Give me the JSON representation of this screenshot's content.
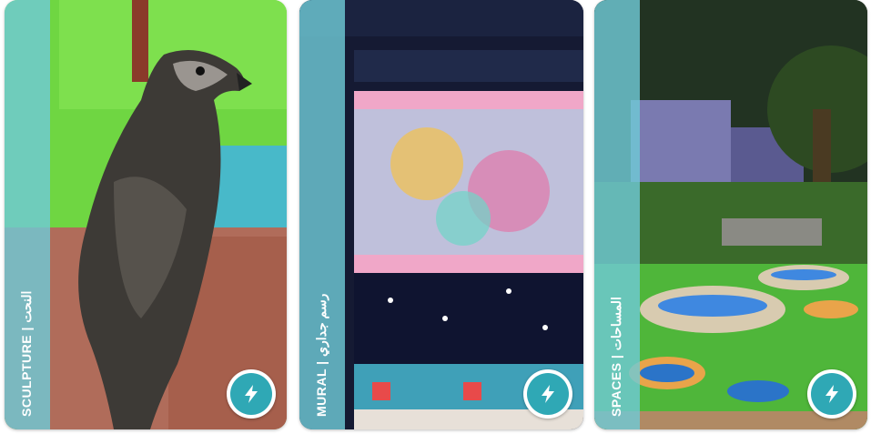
{
  "cards": [
    {
      "label": "SCULPTURE | النحت",
      "category": "Sculpture",
      "badge_icon": "lightning-bolt-icon"
    },
    {
      "label": "MURAL | رسم جداري",
      "category": "Mural",
      "badge_icon": "lightning-bolt-icon"
    },
    {
      "label": "SPACES | المساحات",
      "category": "Spaces",
      "badge_icon": "lightning-bolt-icon"
    }
  ],
  "colors": {
    "band": "#6fc9d6",
    "badge": "#2fa8b5",
    "badge_ring": "#ffffff"
  }
}
